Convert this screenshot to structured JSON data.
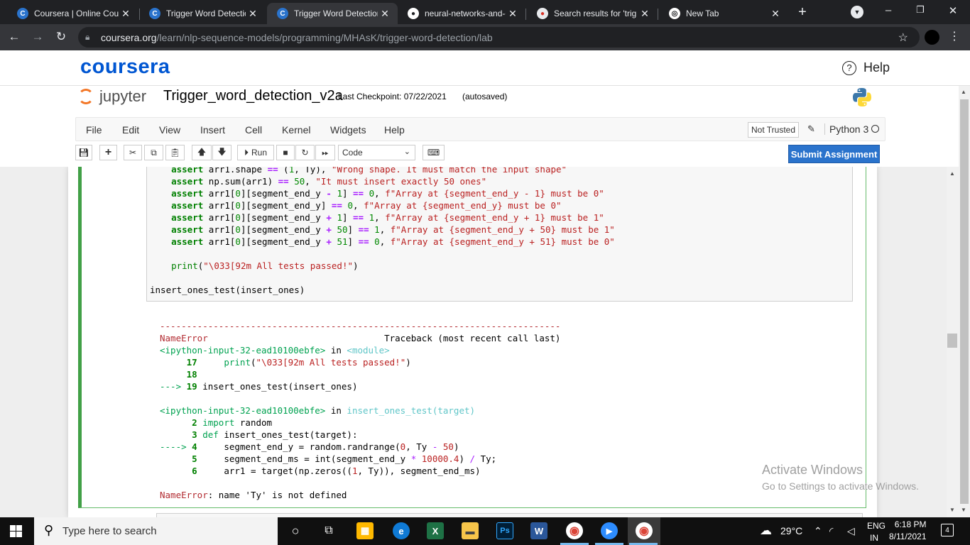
{
  "browser": {
    "tabs": [
      {
        "title": "Coursera | Online Cour",
        "favicon": "C"
      },
      {
        "title": "Trigger Word Detection",
        "favicon": "C"
      },
      {
        "title": "Trigger Word Detection",
        "favicon": "C"
      },
      {
        "title": "neural-networks-and-d",
        "favicon": "gh"
      },
      {
        "title": "Search results for 'trig",
        "favicon": "search"
      },
      {
        "title": "New Tab",
        "favicon": "chrome"
      }
    ],
    "url_host": "coursera.org",
    "url_path": "/learn/nlp-sequence-models/programming/MHAsK/trigger-word-detection/lab"
  },
  "coursera": {
    "logo": "coursera",
    "help": "Help"
  },
  "jupyter": {
    "logo": "jupyter",
    "notebook_title": "Trigger_word_detection_v2a",
    "checkpoint": "Last Checkpoint: 07/22/2021",
    "autosaved": "(autosaved)",
    "menus": [
      "File",
      "Edit",
      "View",
      "Insert",
      "Cell",
      "Kernel",
      "Widgets",
      "Help"
    ],
    "not_trusted": "Not Trusted",
    "kernel": "Python 3",
    "run_label": "Run",
    "cell_type": "Code",
    "submit": "Submit Assignment"
  },
  "code_lines": [
    "    assert arr1.shape == (1, Ty), \"Wrong shape. It must match the input shape\"",
    "    assert np.sum(arr1) == 50, \"It must insert exactly 50 ones\"",
    "    assert arr1[0][segment_end_y - 1] == 0, f\"Array at {segment_end_y - 1} must be 0\"",
    "    assert arr1[0][segment_end_y] == 0, f\"Array at {segment_end_y} must be 0\"",
    "    assert arr1[0][segment_end_y + 1] == 1, f\"Array at {segment_end_y + 1} must be 1\"",
    "    assert arr1[0][segment_end_y + 50] == 1, f\"Array at {segment_end_y + 50} must be 1\"",
    "    assert arr1[0][segment_end_y + 51] == 0, f\"Array at {segment_end_y + 51} must be 0\"",
    "",
    "    print(\"\\033[92m All tests passed!\")",
    "",
    "insert_ones_test(insert_ones)"
  ],
  "traceback": {
    "dashes": "---------------------------------------------------------------------------",
    "error_name": "NameError",
    "traceback_header": "Traceback (most recent call last)",
    "frame1_file": "<ipython-input-32-ead10100ebfe>",
    "frame1_in": "in",
    "frame1_func": "<module>",
    "frame1_lines": [
      {
        "arrow": "     ",
        "num": "17",
        "code": "    print(\"\\033[92m All tests passed!\")"
      },
      {
        "arrow": "     ",
        "num": "18",
        "code": ""
      },
      {
        "arrow": "---> ",
        "num": "19",
        "code": "insert_ones_test(insert_ones)"
      }
    ],
    "frame2_file": "<ipython-input-32-ead10100ebfe>",
    "frame2_in": "in",
    "frame2_func": "insert_ones_test(target)",
    "frame2_lines": [
      {
        "arrow": "      ",
        "num": "2",
        "code": "import random"
      },
      {
        "arrow": "      ",
        "num": "3",
        "code": "def insert_ones_test(target):"
      },
      {
        "arrow": "----> ",
        "num": "4",
        "code": "    segment_end_y = random.randrange(0, Ty - 50)"
      },
      {
        "arrow": "      ",
        "num": "5",
        "code": "    segment_end_ms = int(segment_end_y * 10000.4) / Ty;"
      },
      {
        "arrow": "      ",
        "num": "6",
        "code": "    arr1 = target(np.zeros((1, Ty)), segment_end_ms)"
      }
    ],
    "final_error": "NameError",
    "final_msg": ": name 'Ty' is not defined"
  },
  "watermark": {
    "line1": "Activate Windows",
    "line2": "Go to Settings to activate Windows."
  },
  "taskbar": {
    "search_placeholder": "Type here to search",
    "weather": "29°C",
    "lang1": "ENG",
    "lang2": "IN",
    "time": "6:18 PM",
    "date": "8/11/2021",
    "notifications": "4"
  }
}
